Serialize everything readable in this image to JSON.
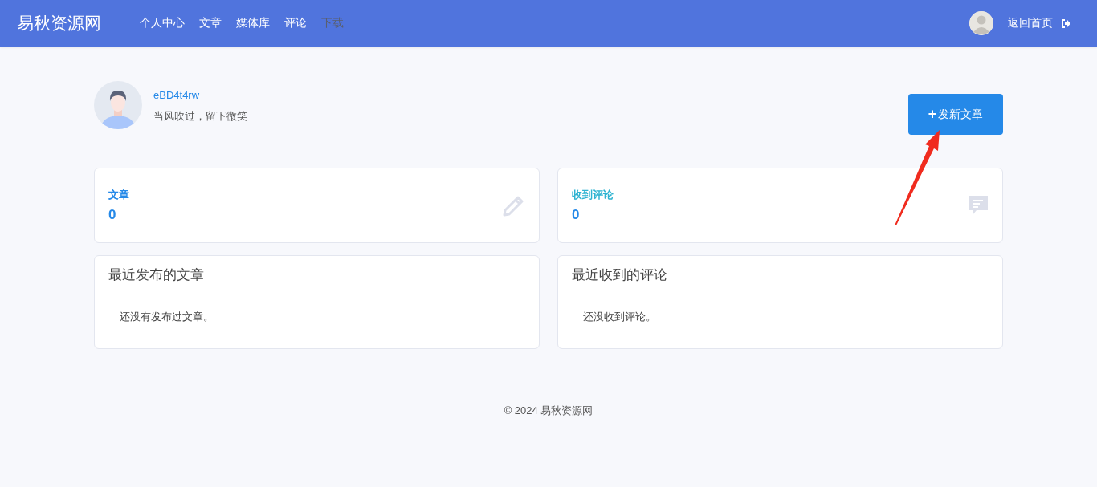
{
  "header": {
    "logo": "易秋资源网",
    "nav": [
      {
        "label": "个人中心",
        "disabled": false
      },
      {
        "label": "文章",
        "disabled": false
      },
      {
        "label": "媒体库",
        "disabled": false
      },
      {
        "label": "评论",
        "disabled": false
      },
      {
        "label": "下载",
        "disabled": true
      }
    ],
    "home_link": "返回首页"
  },
  "profile": {
    "username": "eBD4t4rw",
    "motto": "当风吹过，留下微笑"
  },
  "new_post_button": {
    "icon": "+",
    "label": "发新文章"
  },
  "stats": [
    {
      "kind": "posts",
      "label": "文章",
      "value": "0",
      "color": "#2589e8"
    },
    {
      "kind": "comments",
      "label": "收到评论",
      "value": "0",
      "color": "#2eb3d1"
    }
  ],
  "panels": [
    {
      "title": "最近发布的文章",
      "empty_text": "还没有发布过文章。"
    },
    {
      "title": "最近收到的评论",
      "empty_text": "还没收到评论。"
    }
  ],
  "footer": "© 2024 易秋资源网"
}
